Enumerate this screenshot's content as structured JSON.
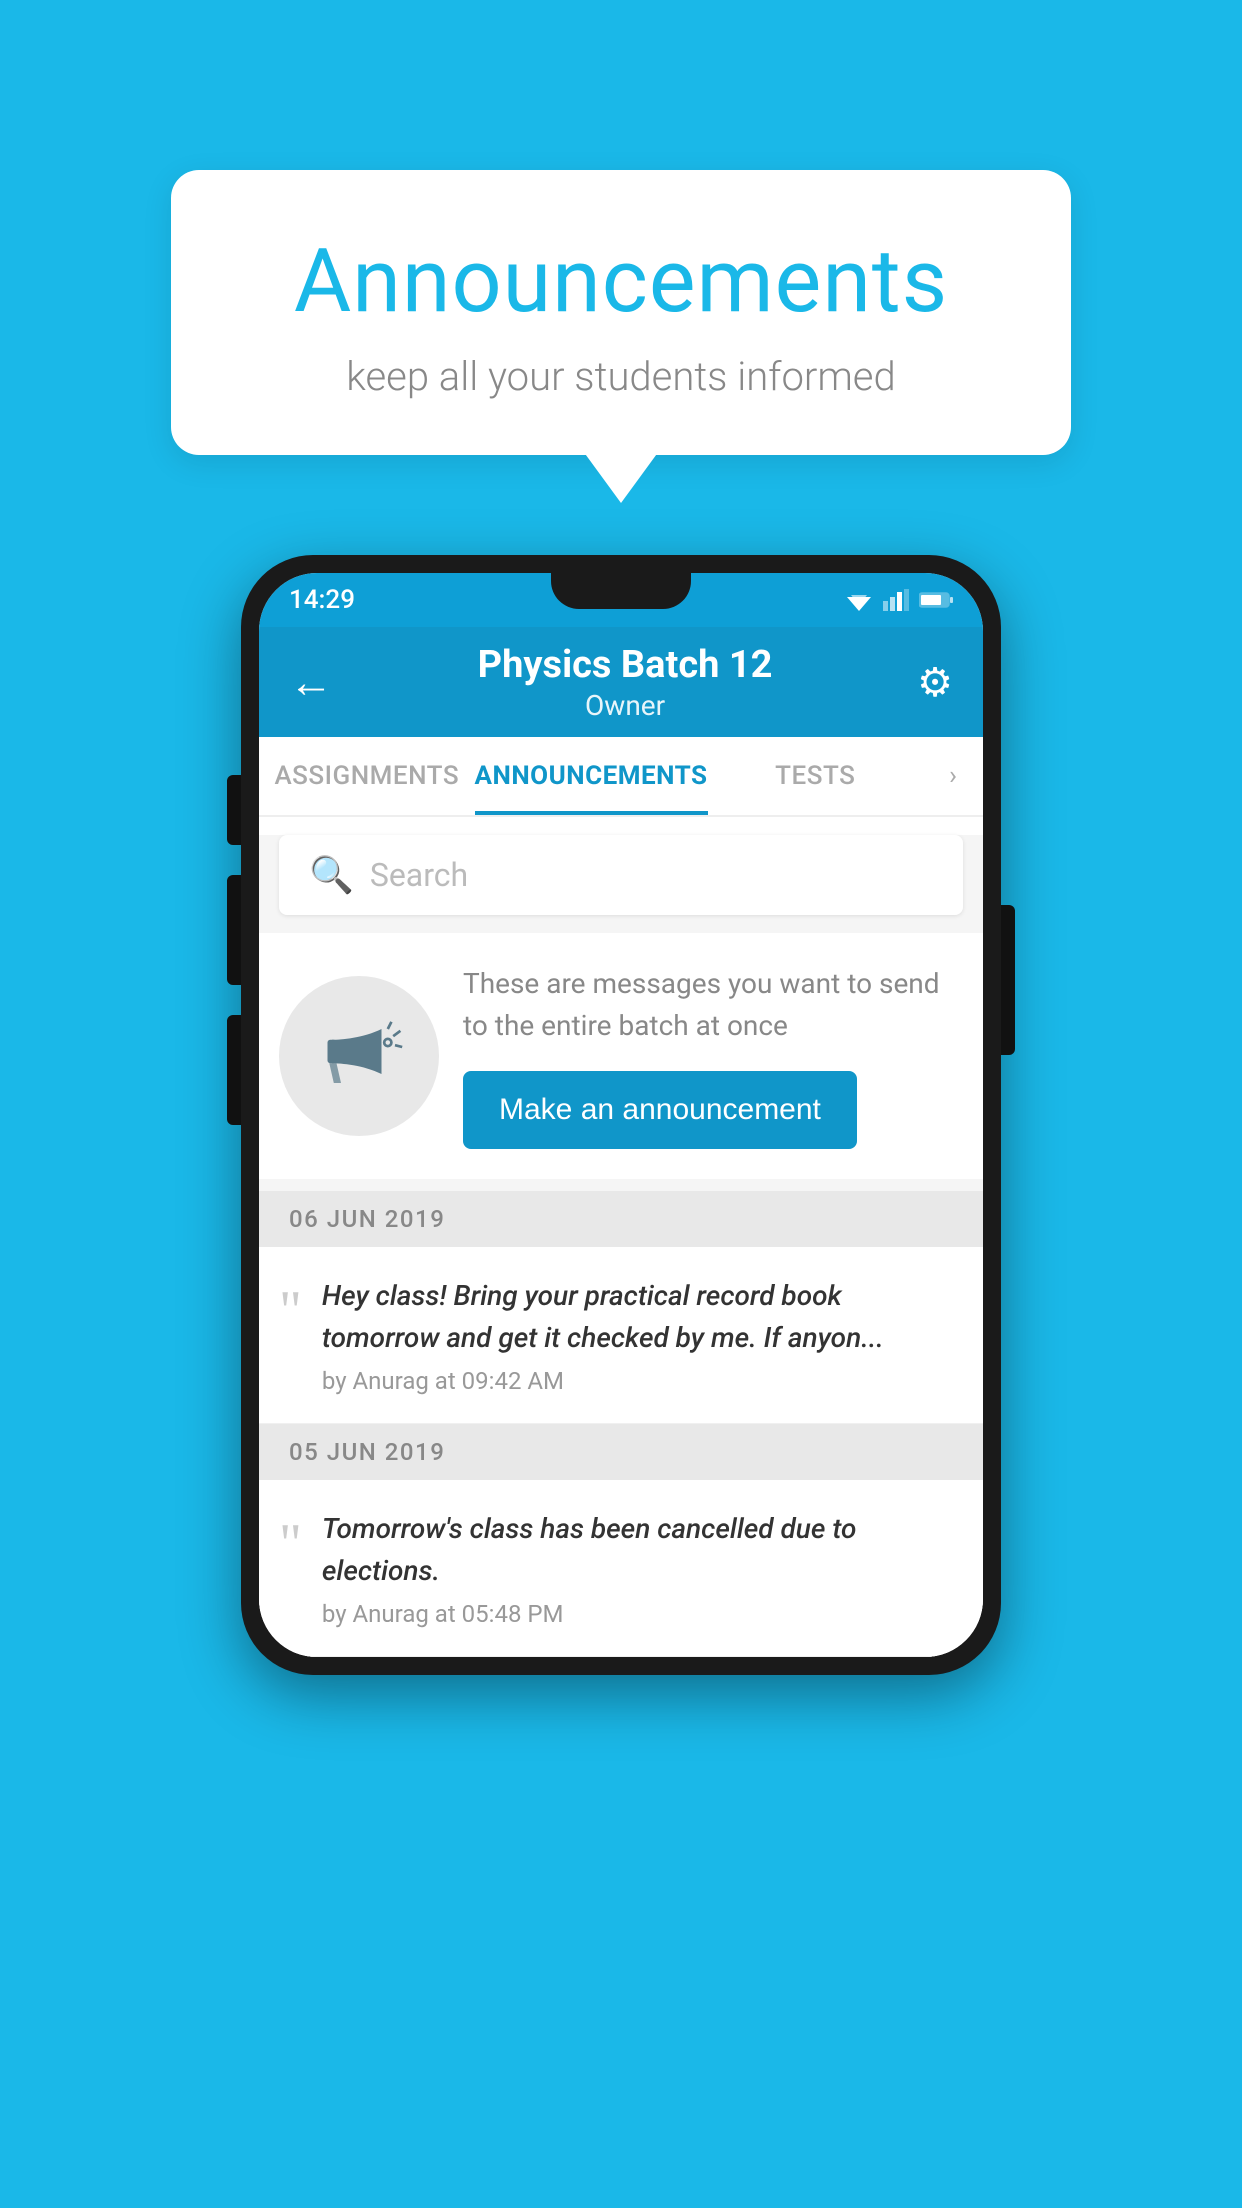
{
  "page": {
    "background_color": "#1ab8e8"
  },
  "bubble": {
    "title": "Announcements",
    "subtitle": "keep all your students informed"
  },
  "status_bar": {
    "time": "14:29"
  },
  "app_bar": {
    "title": "Physics Batch 12",
    "subtitle": "Owner",
    "back_label": "←",
    "gear_label": "⚙"
  },
  "tabs": [
    {
      "id": "assignments",
      "label": "ASSIGNMENTS",
      "active": false
    },
    {
      "id": "announcements",
      "label": "ANNOUNCEMENTS",
      "active": true
    },
    {
      "id": "tests",
      "label": "TESTS",
      "active": false
    }
  ],
  "search": {
    "placeholder": "Search"
  },
  "promo": {
    "description": "These are messages you want to send to the entire batch at once",
    "cta_button": "Make an announcement"
  },
  "announcements": [
    {
      "date": "06  JUN  2019",
      "text": "Hey class! Bring your practical record book tomorrow and get it checked by me. If anyon...",
      "by": "by Anurag at 09:42 AM"
    },
    {
      "date": "05  JUN  2019",
      "text": "Tomorrow's class has been cancelled due to elections.",
      "by": "by Anurag at 05:48 PM"
    }
  ]
}
